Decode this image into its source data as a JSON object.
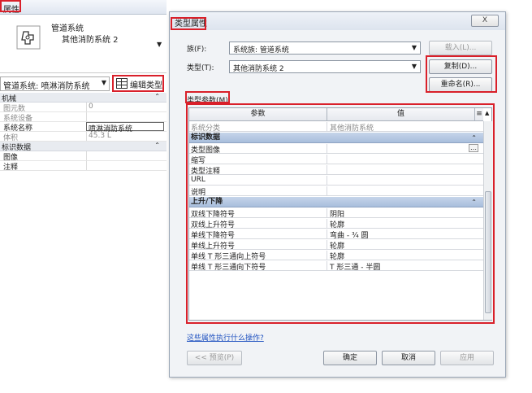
{
  "left_panel": {
    "title": "属性",
    "type_line1": "管道系统",
    "type_line2": "其他消防系统 2",
    "filter_value": "管道系统: 喷淋消防系统",
    "edit_type_label": "编辑类型",
    "groups": [
      {
        "name": "机械",
        "rows": [
          {
            "k": "图元数",
            "v": "0",
            "dim": true
          },
          {
            "k": "系统设备",
            "v": "",
            "dim": true
          },
          {
            "k": "系统名称",
            "v": "喷淋消防系统",
            "dim": false,
            "box": true
          },
          {
            "k": "体积",
            "v": "45.3 L",
            "dim": true
          }
        ]
      },
      {
        "name": "标识数据",
        "rows": [
          {
            "k": "图像",
            "v": "",
            "dim": false
          },
          {
            "k": "注释",
            "v": "",
            "dim": false
          }
        ]
      }
    ]
  },
  "dialog": {
    "title": "类型属性",
    "close_label": "X",
    "family_label": "族(F):",
    "family_value": "系统族: 管道系统",
    "load_label": "载入(L)...",
    "type_label": "类型(T):",
    "type_value": "其他消防系统 2",
    "duplicate_label": "复制(D)...",
    "rename_label": "重命名(R)...",
    "params_label": "类型参数(M)",
    "col_param": "参数",
    "col_value": "值",
    "rows": [
      {
        "kind": "row",
        "k": "系统分类",
        "v": "其他消防系统",
        "dim": true
      },
      {
        "kind": "group",
        "name": "标识数据"
      },
      {
        "kind": "row",
        "k": "类型图像",
        "v": "",
        "dim": false
      },
      {
        "kind": "row",
        "k": "缩写",
        "v": "",
        "dim": false
      },
      {
        "kind": "row",
        "k": "类型注释",
        "v": "",
        "dim": false
      },
      {
        "kind": "row",
        "k": "URL",
        "v": "",
        "dim": false
      },
      {
        "kind": "row",
        "k": "说明",
        "v": "",
        "dim": false
      },
      {
        "kind": "group",
        "name": "上升/下降"
      },
      {
        "kind": "row",
        "k": "双线下降符号",
        "v": "阴阳",
        "dim": false
      },
      {
        "kind": "row",
        "k": "双线上升符号",
        "v": "轮廓",
        "dim": false
      },
      {
        "kind": "row",
        "k": "单线下降符号",
        "v": "弯曲 - ¾ 圆",
        "dim": false
      },
      {
        "kind": "row",
        "k": "单线上升符号",
        "v": "轮廓",
        "dim": false
      },
      {
        "kind": "row",
        "k": "单线 T 形三通向上符号",
        "v": "轮廓",
        "dim": false
      },
      {
        "kind": "row",
        "k": "单线 T 形三通向下符号",
        "v": "T 形三通 - 半圆",
        "dim": false
      }
    ],
    "help_link": "这些属性执行什么操作?",
    "preview_label": "<< 预览(P)",
    "ok_label": "确定",
    "cancel_label": "取消",
    "apply_label": "应用"
  }
}
